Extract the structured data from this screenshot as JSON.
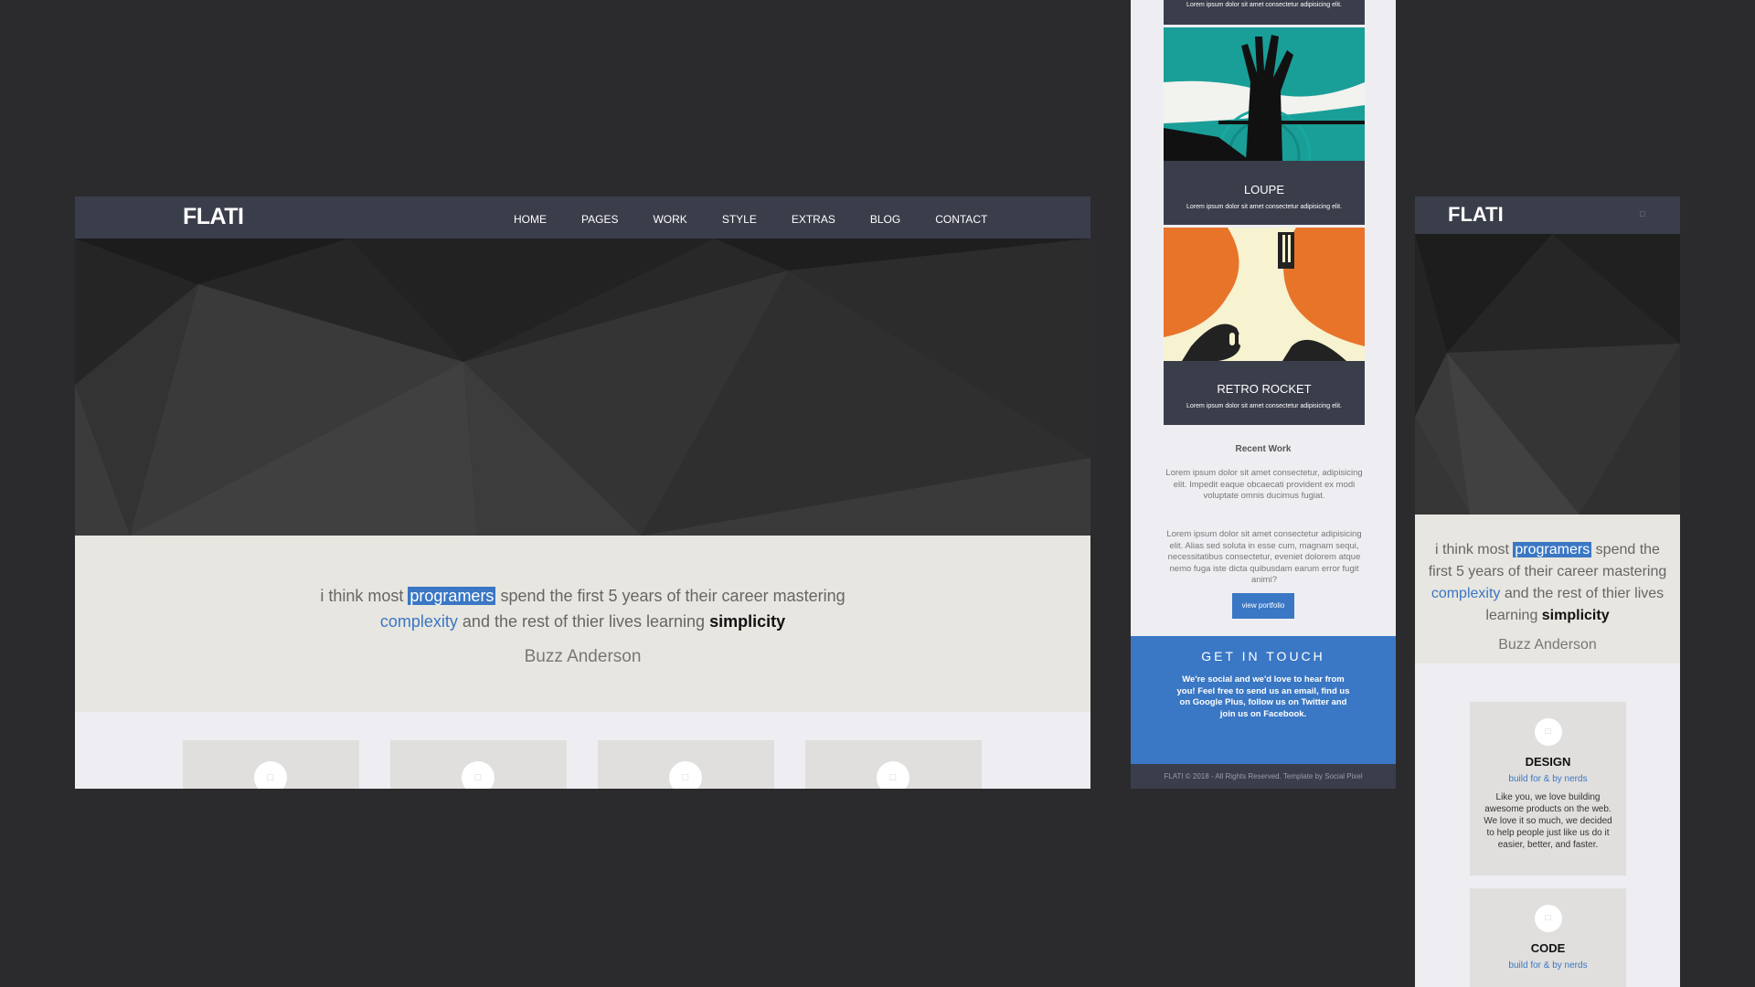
{
  "brand": "FLATI",
  "nav": [
    "HOME",
    "PAGES",
    "WORK",
    "STYLE",
    "EXTRAS",
    "BLOG",
    "CONTACT"
  ],
  "quote": {
    "p1": "i think most ",
    "highlight": "programers",
    "p2": " spend the first 5 years of their career mastering",
    "blue": "complexity",
    "p3": " and the rest of thier lives learning ",
    "bold": "simplicity",
    "author": "Buzz Anderson"
  },
  "card_icons": [
    "□",
    "□",
    "□",
    "□"
  ],
  "portfolio": [
    {
      "title": "",
      "caption": "Lorem ipsum dolor sit amet consectetur adipisicing elit."
    },
    {
      "title": "LOUPE",
      "caption": "Lorem ipsum dolor sit amet consectetur adipisicing elit."
    },
    {
      "title": "RETRO ROCKET",
      "caption": "Lorem ipsum dolor sit amet consectetur adipisicing elit."
    }
  ],
  "recent_work": {
    "heading": "Recent Work",
    "p1": "Lorem ipsum dolor sit amet consectetur, adipisicing elit. Impedit eaque obcaecati provident ex modi voluptate omnis ducimus fugiat.",
    "p2": "Lorem ipsum dolor sit amet consectetur adipisicing elit. Alias sed soluta in esse cum, magnam sequi, necessitatibus consectetur, eveniet dolorem atque nemo fuga iste dicta quibusdam earum error fugit animi?",
    "button": "view portfolio"
  },
  "get_in_touch": {
    "heading": "GET IN TOUCH",
    "text": "We're social and we'd love to hear from you! Feel free to send us an email, find us on Google Plus, follow us on Twitter and join us on Facebook."
  },
  "footer": "FLATI © 2018 - All Rights Reserved. Template by Social Pixel",
  "mobile": {
    "menu_icon": "□",
    "services": [
      {
        "icon": "□",
        "title": "DESIGN",
        "sub": "build for & by nerds",
        "desc": "Like you, we love building awesome products on the web. We love it so much, we decided to help people just like us do it easier, better, and faster."
      },
      {
        "icon": "□",
        "title": "CODE",
        "sub": "build for & by nerds",
        "desc": ""
      }
    ]
  },
  "colors": {
    "accent": "#3a77c4",
    "nav": "#3a3d4a",
    "quote_bg": "#e8e6e0",
    "page_bg": "#2b2b2e"
  }
}
